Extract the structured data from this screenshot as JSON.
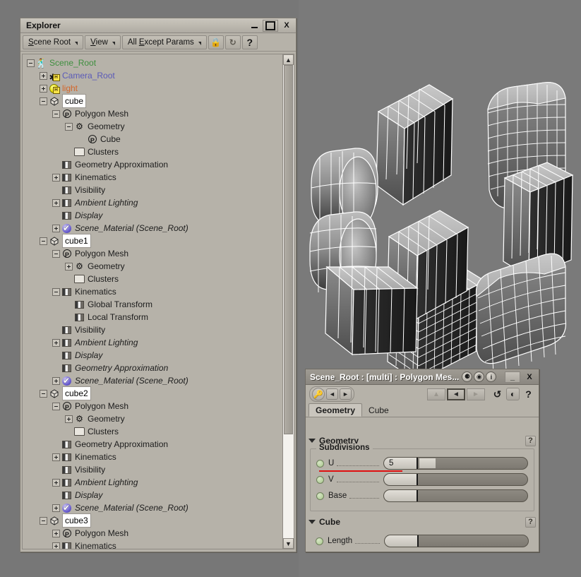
{
  "explorer": {
    "title": "Explorer",
    "window_buttons": [
      {
        "name": "minimize",
        "label": "_"
      },
      {
        "name": "maximize",
        "label": "□"
      },
      {
        "name": "close",
        "label": "X"
      }
    ],
    "toolbar": {
      "scope_button": {
        "pre": "S",
        "mnemonic": "",
        "text_before": "",
        "label_a": "S",
        "label_b": "cene Root"
      },
      "view_button": {
        "label_a": "V",
        "label_b": "iew"
      },
      "filter_button": {
        "label_a": "All ",
        "mnemonic": "E",
        "label_b": "xcept Params"
      },
      "lock_icon": "lock-icon",
      "refresh_icon": "refresh-icon",
      "help_label": "?"
    },
    "tree": [
      {
        "depth": 0,
        "expander": "minus",
        "icon": "person-icon",
        "label": "Scene_Root",
        "style": "green"
      },
      {
        "depth": 1,
        "expander": "plus",
        "icon": "camera-icon",
        "label": "Camera_Root",
        "style": "blue"
      },
      {
        "depth": 1,
        "expander": "plus",
        "icon": "light-icon",
        "label": "light",
        "style": "orange"
      },
      {
        "depth": 1,
        "expander": "minus",
        "icon": "cube-icon",
        "label": "cube",
        "style": "selected"
      },
      {
        "depth": 2,
        "expander": "minus",
        "icon": "polymesh-icon",
        "label": "Polygon Mesh",
        "style": "normal"
      },
      {
        "depth": 3,
        "expander": "minus",
        "icon": "gear-icon",
        "label": "Geometry",
        "style": "normal"
      },
      {
        "depth": 4,
        "expander": "none",
        "icon": "polymesh-icon",
        "label": "Cube",
        "style": "normal"
      },
      {
        "depth": 3,
        "expander": "none",
        "icon": "folder-icon",
        "label": "Clusters",
        "style": "normal"
      },
      {
        "depth": 2,
        "expander": "none",
        "icon": "property-icon",
        "label": "Geometry Approximation",
        "style": "normal"
      },
      {
        "depth": 2,
        "expander": "plus",
        "icon": "property-icon",
        "label": "Kinematics",
        "style": "normal"
      },
      {
        "depth": 2,
        "expander": "none",
        "icon": "property-icon",
        "label": "Visibility",
        "style": "normal"
      },
      {
        "depth": 2,
        "expander": "plus",
        "icon": "property-icon",
        "label": "Ambient Lighting",
        "style": "italic"
      },
      {
        "depth": 2,
        "expander": "none",
        "icon": "property-icon",
        "label": "Display",
        "style": "italic"
      },
      {
        "depth": 2,
        "expander": "plus",
        "icon": "material-icon",
        "label": "Scene_Material (Scene_Root)",
        "style": "italic"
      },
      {
        "depth": 1,
        "expander": "minus",
        "icon": "cube-icon",
        "label": "cube1",
        "style": "selected"
      },
      {
        "depth": 2,
        "expander": "minus",
        "icon": "polymesh-icon",
        "label": "Polygon Mesh",
        "style": "normal"
      },
      {
        "depth": 3,
        "expander": "plus",
        "icon": "gear-icon",
        "label": "Geometry",
        "style": "normal"
      },
      {
        "depth": 3,
        "expander": "none",
        "icon": "folder-icon",
        "label": "Clusters",
        "style": "normal"
      },
      {
        "depth": 2,
        "expander": "minus",
        "icon": "property-icon",
        "label": "Kinematics",
        "style": "normal"
      },
      {
        "depth": 3,
        "expander": "none",
        "icon": "property-icon",
        "label": "Global Transform",
        "style": "normal"
      },
      {
        "depth": 3,
        "expander": "none",
        "icon": "property-icon",
        "label": "Local Transform",
        "style": "normal"
      },
      {
        "depth": 2,
        "expander": "none",
        "icon": "property-icon",
        "label": "Visibility",
        "style": "normal"
      },
      {
        "depth": 2,
        "expander": "plus",
        "icon": "property-icon",
        "label": "Ambient Lighting",
        "style": "italic"
      },
      {
        "depth": 2,
        "expander": "none",
        "icon": "property-icon",
        "label": "Display",
        "style": "italic"
      },
      {
        "depth": 2,
        "expander": "none",
        "icon": "property-icon",
        "label": "Geometry Approximation",
        "style": "italic"
      },
      {
        "depth": 2,
        "expander": "plus",
        "icon": "material-icon",
        "label": "Scene_Material (Scene_Root)",
        "style": "italic"
      },
      {
        "depth": 1,
        "expander": "minus",
        "icon": "cube-icon",
        "label": "cube2",
        "style": "selected"
      },
      {
        "depth": 2,
        "expander": "minus",
        "icon": "polymesh-icon",
        "label": "Polygon Mesh",
        "style": "normal"
      },
      {
        "depth": 3,
        "expander": "plus",
        "icon": "gear-icon",
        "label": "Geometry",
        "style": "normal"
      },
      {
        "depth": 3,
        "expander": "none",
        "icon": "folder-icon",
        "label": "Clusters",
        "style": "normal"
      },
      {
        "depth": 2,
        "expander": "none",
        "icon": "property-icon",
        "label": "Geometry Approximation",
        "style": "normal"
      },
      {
        "depth": 2,
        "expander": "plus",
        "icon": "property-icon",
        "label": "Kinematics",
        "style": "normal"
      },
      {
        "depth": 2,
        "expander": "none",
        "icon": "property-icon",
        "label": "Visibility",
        "style": "normal"
      },
      {
        "depth": 2,
        "expander": "plus",
        "icon": "property-icon",
        "label": "Ambient Lighting",
        "style": "italic"
      },
      {
        "depth": 2,
        "expander": "none",
        "icon": "property-icon",
        "label": "Display",
        "style": "italic"
      },
      {
        "depth": 2,
        "expander": "plus",
        "icon": "material-icon",
        "label": "Scene_Material (Scene_Root)",
        "style": "italic"
      },
      {
        "depth": 1,
        "expander": "minus",
        "icon": "cube-icon",
        "label": "cube3",
        "style": "selected"
      },
      {
        "depth": 2,
        "expander": "plus",
        "icon": "polymesh-icon",
        "label": "Polygon Mesh",
        "style": "normal"
      },
      {
        "depth": 2,
        "expander": "plus",
        "icon": "property-icon",
        "label": "Kinematics",
        "style": "normal"
      }
    ],
    "scrollbar": {
      "up": "▲",
      "down": "▼",
      "thumb_percent": 78
    }
  },
  "property_panel": {
    "title": "Scene_Root : [multi] : Polygon Mes...",
    "title_icons": [
      "glasses-icon",
      "globe-icon",
      "info-icon"
    ],
    "window_buttons": [
      {
        "name": "minimize",
        "label": "_"
      },
      {
        "name": "close",
        "label": "X"
      }
    ],
    "toolbar": {
      "key_icon": "key-icon",
      "prev_label": "◄",
      "next_label": "►",
      "nav_up_label": "▲",
      "nav_back_label": "◄",
      "nav_forward_label": "►",
      "undo_icon": "undo-icon",
      "lock_icon": "lock-icon",
      "help_label": "?"
    },
    "tabs": [
      {
        "label": "Geometry",
        "active": true
      },
      {
        "label": "Cube",
        "active": false
      }
    ],
    "sections": [
      {
        "name": "geometry",
        "header": "Geometry",
        "help": "?",
        "group_label": "Subdivisions",
        "params": [
          {
            "name": "u",
            "label": "U",
            "value": "5",
            "fill_percent": 15,
            "animated": true,
            "underline": true
          },
          {
            "name": "v",
            "label": "V",
            "value": "",
            "fill_percent": 0,
            "animated": true,
            "underline": false
          },
          {
            "name": "base",
            "label": "Base",
            "value": "",
            "fill_percent": 0,
            "animated": true,
            "underline": false
          }
        ]
      },
      {
        "name": "cube",
        "header": "Cube",
        "help": "?",
        "group_label": "",
        "params": [
          {
            "name": "length",
            "label": "Length",
            "value": "",
            "fill_percent": 0,
            "animated": true,
            "underline": false
          }
        ]
      }
    ]
  },
  "viewport": {
    "name": "3d-viewport",
    "background": "#7a7a7a",
    "wireframe_color": "#ffffff",
    "objects": [
      {
        "name": "cube-u5-top-left",
        "kind": "box",
        "subdiv_u": 5
      },
      {
        "name": "cube-dense-top-right",
        "kind": "rounded",
        "subdiv_u": 8
      },
      {
        "name": "cylinder-left-upper",
        "kind": "cylinder",
        "subdiv_u": 6
      },
      {
        "name": "cube-center-dense",
        "kind": "box",
        "subdiv_u": 8
      },
      {
        "name": "cube-right-mid",
        "kind": "box",
        "subdiv_u": 6
      },
      {
        "name": "cylinder-left-lower",
        "kind": "cylinder",
        "subdiv_u": 6
      },
      {
        "name": "cube-center-mid",
        "kind": "box",
        "subdiv_u": 6
      },
      {
        "name": "cube-bottom-left",
        "kind": "box",
        "subdiv_u": 6
      },
      {
        "name": "cube-bottom-right",
        "kind": "rounded",
        "subdiv_u": 8
      }
    ]
  }
}
